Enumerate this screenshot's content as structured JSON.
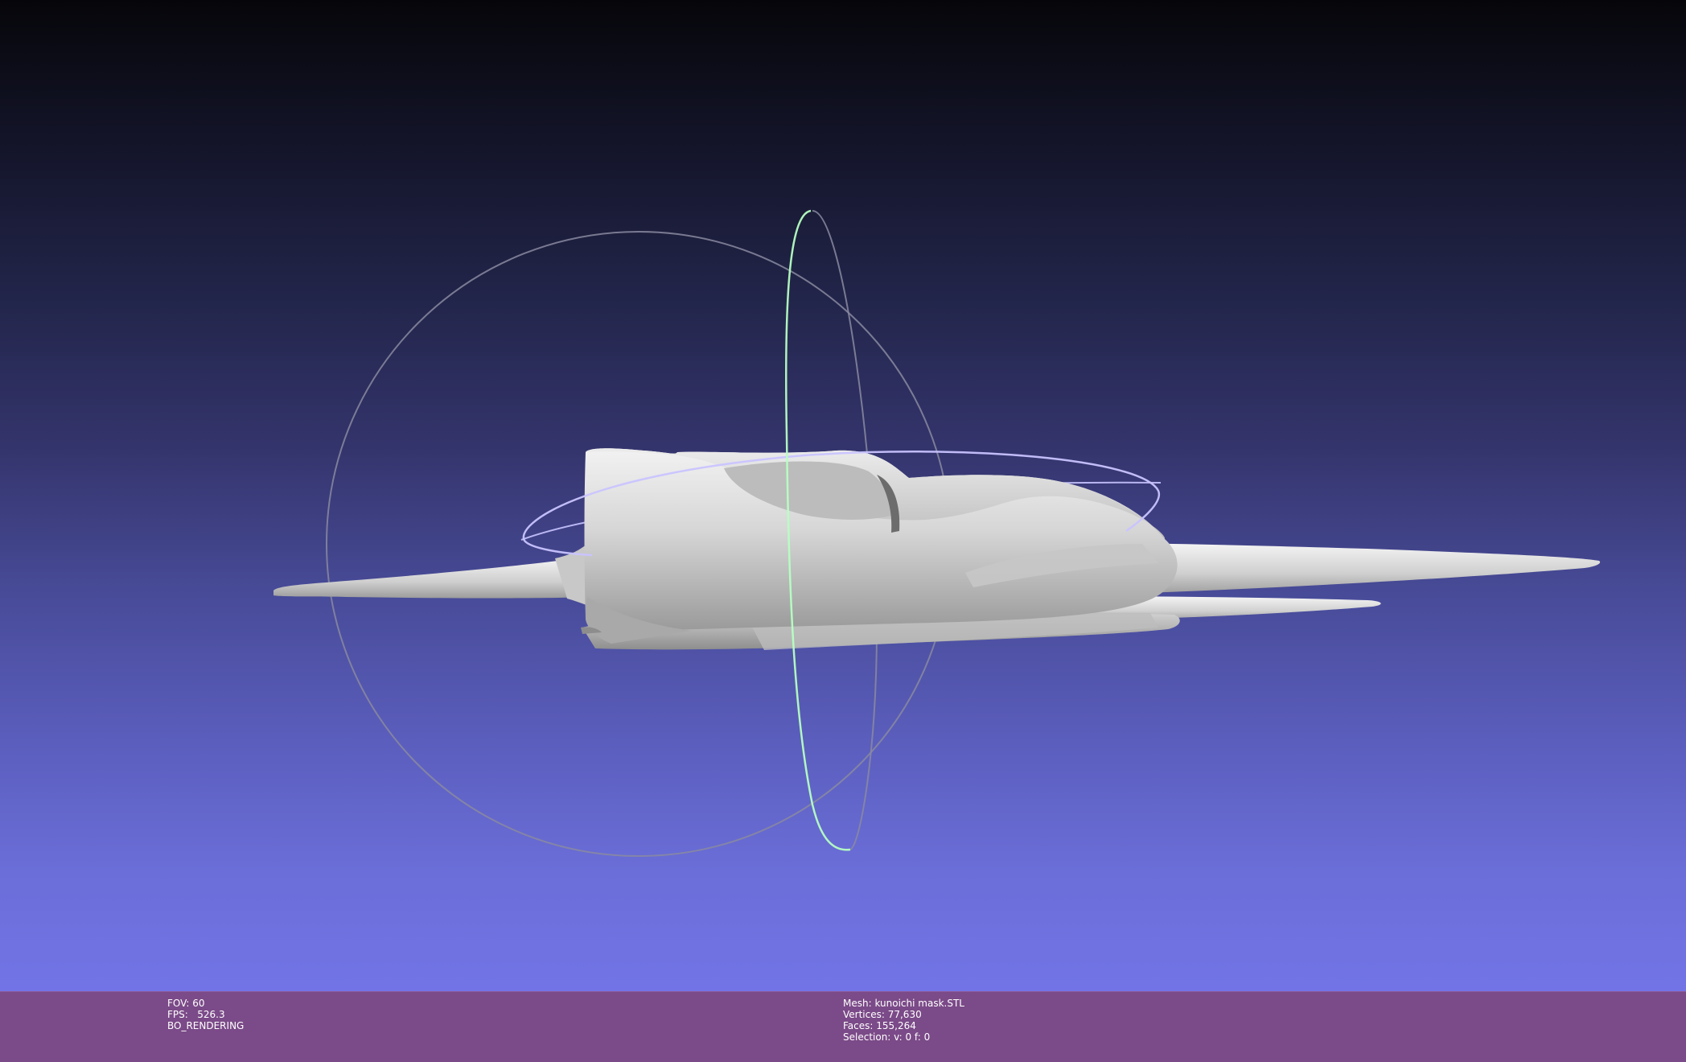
{
  "viewer": {
    "background_top": "#06060a",
    "background_bottom": "#7274e6",
    "status_bar_color": "#7b4a88"
  },
  "render_info": {
    "fov": "FOV: 60",
    "fps": "FPS:   526.3",
    "mode": "BO_RENDERING"
  },
  "mesh_info": {
    "mesh": "Mesh: kunoichi mask.STL",
    "vertices": "Vertices: 77,630",
    "faces": "Faces: 155,264",
    "selection": "Selection: v: 0 f: 0"
  },
  "trackball": {
    "ring_horizontal_color": "#c9c4ff",
    "ring_vertical_color": "#b6ffc2",
    "ring_outline_color": "#8a8aa0"
  },
  "model": {
    "name": "kunoichi mask",
    "color": "#d9d9d9"
  }
}
